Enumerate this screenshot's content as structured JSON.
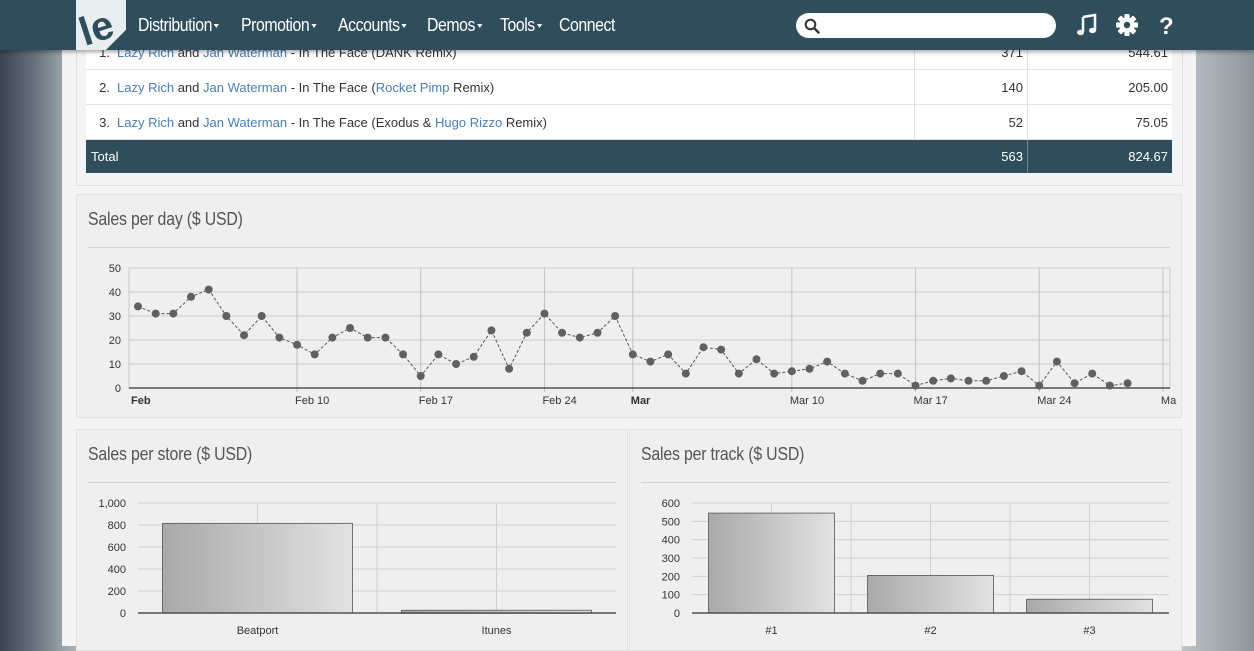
{
  "nav": {
    "menu": [
      {
        "label": "Distribution",
        "caret": true
      },
      {
        "label": "Promotion",
        "caret": true
      },
      {
        "label": "Accounts",
        "caret": true
      },
      {
        "label": "Demos",
        "caret": true
      },
      {
        "label": "Tools",
        "caret": true
      },
      {
        "label": "Connect",
        "caret": false
      }
    ],
    "search_placeholder": "",
    "icons": [
      "music-icon",
      "gear-icon",
      "help-icon"
    ]
  },
  "table": {
    "rows": [
      {
        "num": "1.",
        "artist1": "Lazy Rich",
        "and": "and",
        "artist2": "Jan Waterman",
        "title_pre": "- In The Face (",
        "remixer": "",
        "title_post": "DANK Remix)",
        "qty": "371",
        "amount": "544.61"
      },
      {
        "num": "2.",
        "artist1": "Lazy Rich",
        "and": "and",
        "artist2": "Jan Waterman",
        "title_pre": "- In The Face (",
        "remixer": "Rocket Pimp",
        "title_post": " Remix)",
        "qty": "140",
        "amount": "205.00"
      },
      {
        "num": "3.",
        "artist1": "Lazy Rich",
        "and": "and",
        "artist2": "Jan Waterman",
        "title_pre": "- In The Face (Exodus & ",
        "remixer": "Hugo Rizzo",
        "title_post": " Remix)",
        "qty": "52",
        "amount": "75.05"
      }
    ],
    "total": {
      "label": "Total",
      "qty": "563",
      "amount": "824.67"
    }
  },
  "colors": {
    "navbar": "#2f4d5a",
    "link": "#4a7fb8",
    "total_row": "#2f4d5a"
  },
  "chart_data": [
    {
      "type": "line",
      "title": "Sales per day ($ USD)",
      "ylim": [
        0,
        50
      ],
      "yticks": [
        0,
        10,
        20,
        30,
        40,
        50
      ],
      "x_tick_labels": [
        {
          "day": 0,
          "label": "Feb",
          "bold": true
        },
        {
          "day": 9,
          "label": "Feb 10",
          "bold": false
        },
        {
          "day": 16,
          "label": "Feb 17",
          "bold": false
        },
        {
          "day": 23,
          "label": "Feb 24",
          "bold": false
        },
        {
          "day": 28,
          "label": "Mar",
          "bold": true
        },
        {
          "day": 37,
          "label": "Mar 10",
          "bold": false
        },
        {
          "day": 44,
          "label": "Mar 17",
          "bold": false
        },
        {
          "day": 51,
          "label": "Mar 24",
          "bold": false
        },
        {
          "day": 58,
          "label": "Ma",
          "bold": false
        }
      ],
      "grid": true,
      "series": [
        {
          "values": [
            34,
            31,
            31,
            38,
            41,
            30,
            22,
            30,
            21,
            18,
            14,
            21,
            25,
            21,
            21,
            14,
            5,
            14,
            10,
            13,
            24,
            8,
            23,
            31,
            23,
            21,
            23,
            30,
            14,
            11,
            14,
            6,
            17,
            16,
            6,
            12,
            6,
            7,
            8,
            11,
            6,
            3,
            6,
            6,
            1,
            3,
            4,
            3,
            3,
            5,
            7,
            1,
            11,
            2,
            6,
            1,
            2
          ]
        }
      ]
    },
    {
      "type": "bar",
      "title": "Sales per store ($ USD)",
      "categories": [
        "Beatport",
        "Itunes"
      ],
      "values": [
        815,
        25
      ],
      "ylim": [
        0,
        1000
      ],
      "yticks": [
        "0",
        "200",
        "400",
        "600",
        "800",
        "1,000"
      ],
      "grid": true
    },
    {
      "type": "bar",
      "title": "Sales per track ($ USD)",
      "categories": [
        "#1",
        "#2",
        "#3"
      ],
      "values": [
        545,
        205,
        75
      ],
      "ylim": [
        0,
        600
      ],
      "yticks": [
        "0",
        "100",
        "200",
        "300",
        "400",
        "500",
        "600"
      ],
      "grid": true
    }
  ]
}
